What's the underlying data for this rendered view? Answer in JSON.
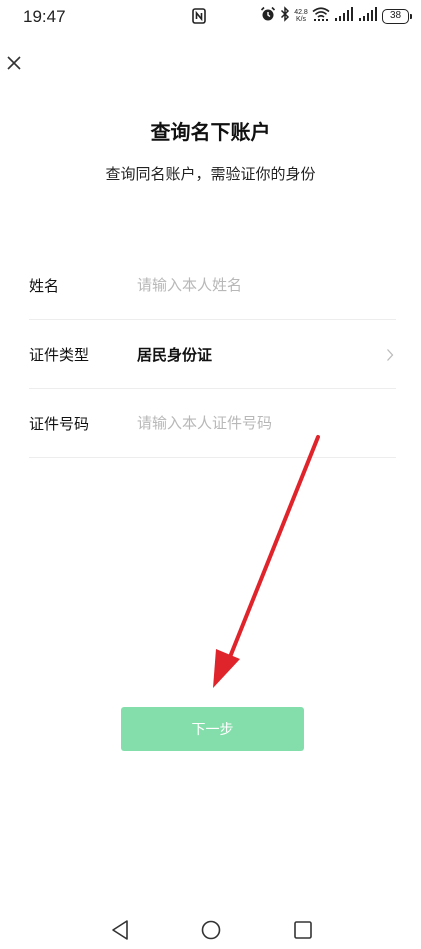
{
  "status_bar": {
    "time": "19:47",
    "net_speed_value": "42.8",
    "net_speed_unit": "K/s",
    "battery": "38",
    "icons": [
      "nfc-icon",
      "alarm-icon",
      "bluetooth-icon",
      "wifi-icon",
      "signal-icon",
      "signal-icon",
      "battery-icon"
    ]
  },
  "header": {
    "close_icon": "close-icon"
  },
  "main": {
    "title": "查询名下账户",
    "subtitle": "查询同名账户，需验证你的身份"
  },
  "form": {
    "name_row": {
      "label": "姓名",
      "value": "",
      "placeholder": "请输入本人姓名"
    },
    "id_type_row": {
      "label": "证件类型",
      "value": "居民身份证"
    },
    "id_number_row": {
      "label": "证件号码",
      "value": "",
      "placeholder": "请输入本人证件号码"
    }
  },
  "next_button": {
    "label": "下一步",
    "color": "#84deab"
  },
  "annotation": {
    "arrow_color": "#e0242b"
  },
  "nav_bar": {
    "icons": [
      "back-icon",
      "home-icon",
      "recents-icon"
    ]
  }
}
